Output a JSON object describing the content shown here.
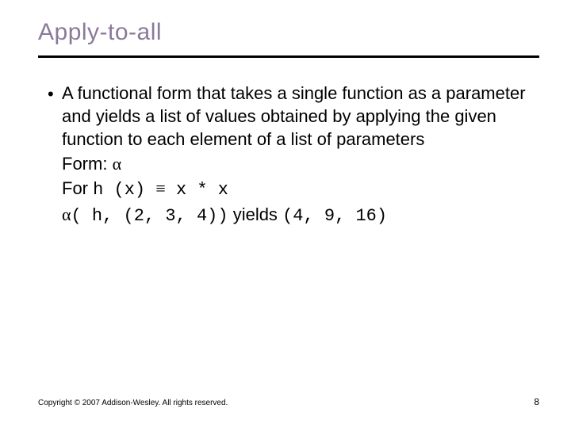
{
  "title": "Apply-to-all",
  "bullet": {
    "marker": "•",
    "para": "A functional form that takes a single function as a parameter and yields a list of values obtained by applying the given function to each element of a list of parameters",
    "form_label": "Form: ",
    "alpha": "α",
    "for_label": "For ",
    "h_def_code": "h (x) ",
    "equiv": "≡",
    "h_def_rhs": " x * x",
    "apply_code_pre": "( h, (2, 3, 4))",
    "yields_label": "  yields  ",
    "result_code": "(4, 9, 16)"
  },
  "footer": "Copyright © 2007 Addison-Wesley. All rights reserved.",
  "page_number": "8"
}
